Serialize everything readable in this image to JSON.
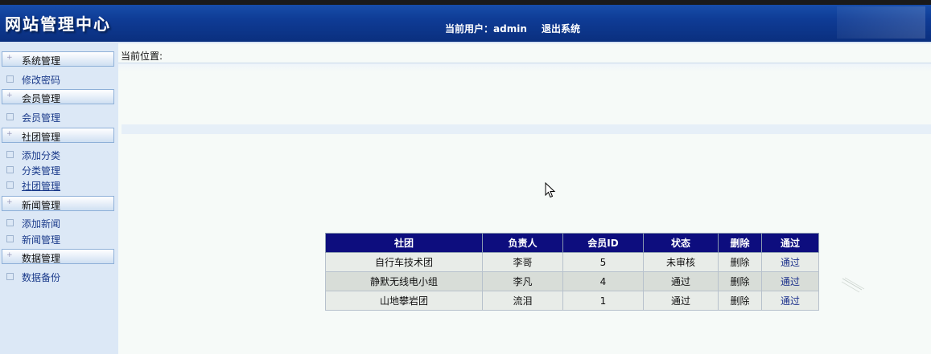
{
  "header": {
    "logo": "网站管理中心",
    "user_label": "当前用户：",
    "user_name": "admin",
    "logout": "退出系统"
  },
  "sidebar": {
    "groups": [
      {
        "title": "系统管理",
        "items": [
          "修改密码"
        ]
      },
      {
        "title": "会员管理",
        "items": [
          "会员管理"
        ]
      },
      {
        "title": "社团管理",
        "items": [
          "添加分类",
          "分类管理",
          "社团管理"
        ]
      },
      {
        "title": "新闻管理",
        "items": [
          "添加新闻",
          "新闻管理"
        ]
      },
      {
        "title": "数据管理",
        "items": [
          "数据备份"
        ]
      }
    ]
  },
  "main": {
    "location_label": "当前位置:",
    "table": {
      "headers": [
        "社团",
        "负责人",
        "会员ID",
        "状态",
        "删除",
        "通过"
      ],
      "rows": [
        {
          "club": "自行车技术团",
          "leader": "李哥",
          "member_id": "5",
          "status": "未审核",
          "delete": "删除",
          "approve": "通过"
        },
        {
          "club": "静默无线电小组",
          "leader": "李凡",
          "member_id": "4",
          "status": "通过",
          "delete": "删除",
          "approve": "通过"
        },
        {
          "club": "山地攀岩团",
          "leader": "流泪",
          "member_id": "1",
          "status": "通过",
          "delete": "删除",
          "approve": "通过"
        }
      ]
    }
  },
  "colors": {
    "header_bg": "#0f3c96",
    "table_header_bg": "#0d0d7e",
    "sidebar_bg": "#dce8f6",
    "link": "#1a2f8a"
  },
  "icons": [
    "mouse-pointer-icon",
    "plus-icon",
    "square-bullet-icon"
  ]
}
